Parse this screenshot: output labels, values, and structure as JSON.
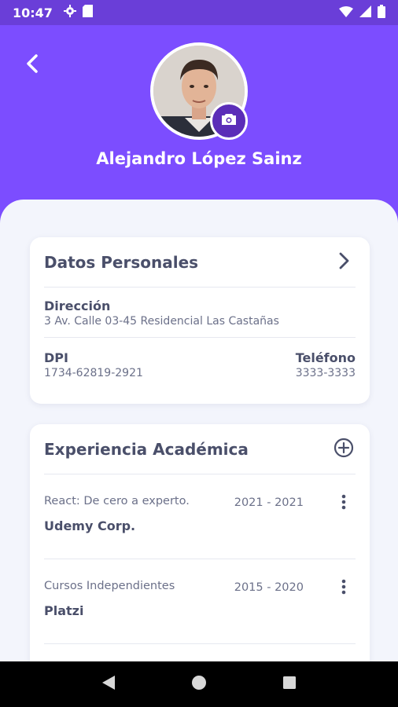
{
  "status_bar": {
    "time": "10:47",
    "left_icons": [
      "gear-icon",
      "sd-card-icon"
    ],
    "right_icons": [
      "wifi-icon",
      "signal-icon",
      "battery-icon"
    ]
  },
  "header": {
    "background_color": "#7C4DFF",
    "back_icon": "chevron-left-icon",
    "profile_name": "Alejandro López Sainz",
    "camera_icon": "camera-icon"
  },
  "personal_card": {
    "title": "Datos Personales",
    "action_icon": "chevron-right-icon",
    "address_label": "Dirección",
    "address_value": "3 Av. Calle 03-45 Residencial Las Castañas",
    "dpi_label": "DPI",
    "dpi_value": "1734-62819-2921",
    "phone_label": "Teléfono",
    "phone_value": "3333-3333"
  },
  "academic_card": {
    "title": "Experiencia Académica",
    "action_icon": "add-circle-icon",
    "items": [
      {
        "course": "React: De cero a experto.",
        "years": "2021 - 2021",
        "organization": "Udemy Corp."
      },
      {
        "course": "Cursos Independientes",
        "years": "2015 - 2020",
        "organization": "Platzi"
      }
    ]
  },
  "nav_bar": {
    "icons": [
      "back-triangle-icon",
      "home-circle-icon",
      "recents-square-icon"
    ]
  }
}
